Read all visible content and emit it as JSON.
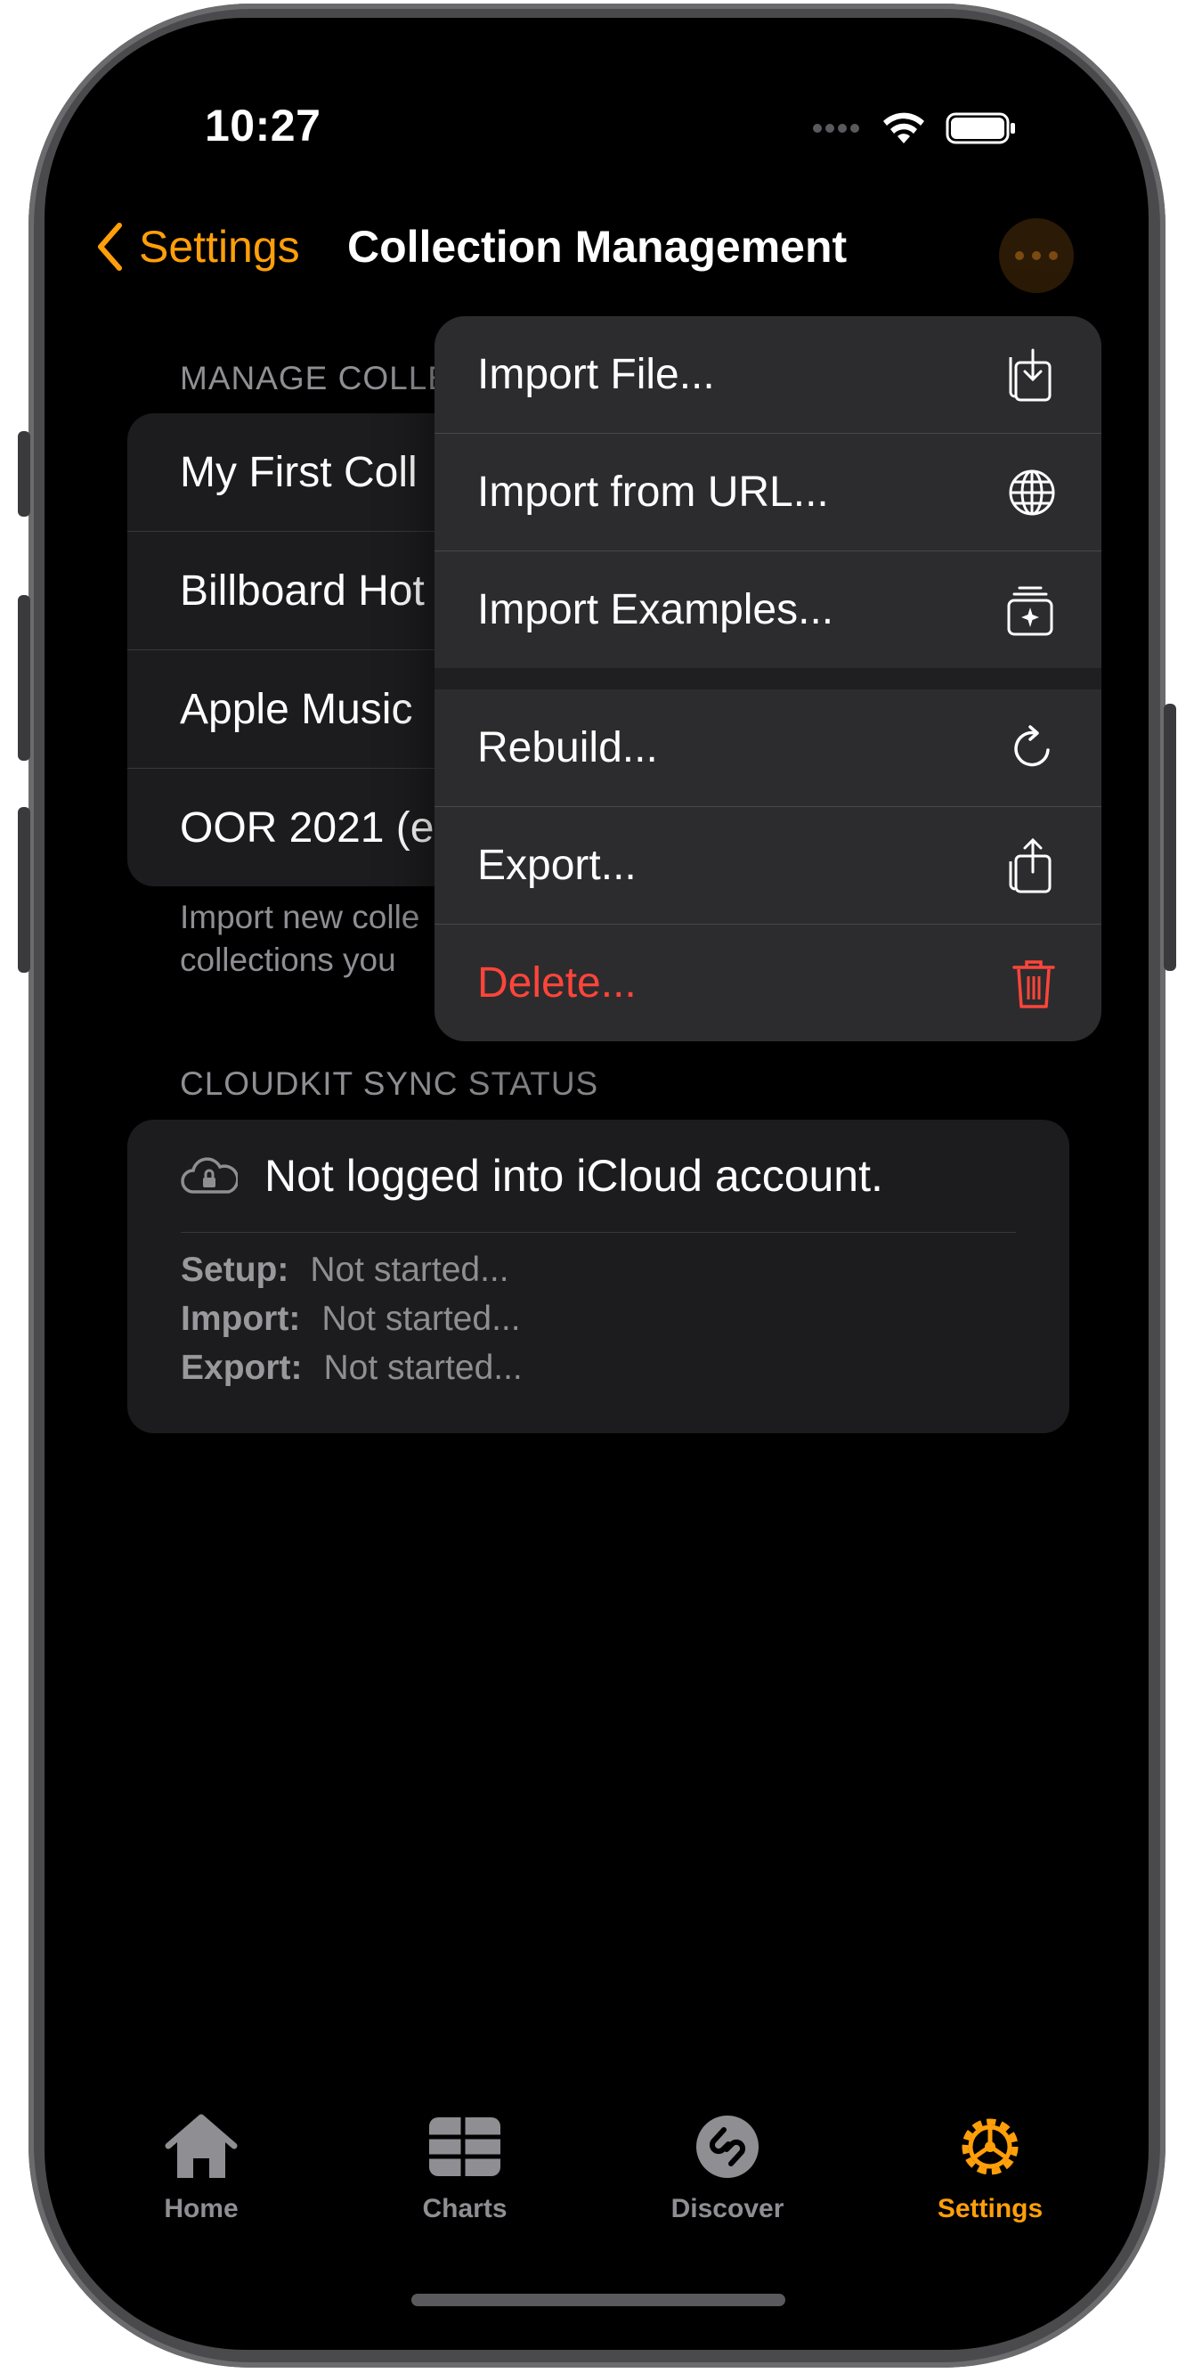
{
  "status_bar": {
    "time": "10:27"
  },
  "nav": {
    "back_label": "Settings",
    "title": "Collection Management"
  },
  "manage_section": {
    "header": "MANAGE COLLE",
    "rows": [
      "My First Coll",
      "Billboard Hot",
      "Apple Music",
      "OOR 2021 (e"
    ],
    "footer_line1": "Import new colle",
    "footer_line2": "collections you"
  },
  "cloudkit_section": {
    "header": "CLOUDKIT SYNC STATUS",
    "status": "Not logged into iCloud account.",
    "setup_label": "Setup:",
    "setup_value": "Not started...",
    "import_label": "Import:",
    "import_value": "Not started...",
    "export_label": "Export:",
    "export_value": "Not started..."
  },
  "menu": {
    "items": [
      {
        "label": "Import File...",
        "icon": "import-file-icon"
      },
      {
        "label": "Import from URL...",
        "icon": "globe-icon"
      },
      {
        "label": "Import Examples...",
        "icon": "examples-icon"
      },
      {
        "label": "Rebuild...",
        "icon": "rebuild-icon"
      },
      {
        "label": "Export...",
        "icon": "share-icon"
      },
      {
        "label": "Delete...",
        "icon": "trash-icon"
      }
    ]
  },
  "tabs": [
    {
      "label": "Home",
      "icon": "house-icon"
    },
    {
      "label": "Charts",
      "icon": "charts-grid-icon"
    },
    {
      "label": "Discover",
      "icon": "shazam-icon"
    },
    {
      "label": "Settings",
      "icon": "gear-icon"
    }
  ],
  "colors": {
    "accent": "#ff9f0a",
    "danger": "#ff453a",
    "background": "#000000",
    "card": "#1c1c1e"
  }
}
